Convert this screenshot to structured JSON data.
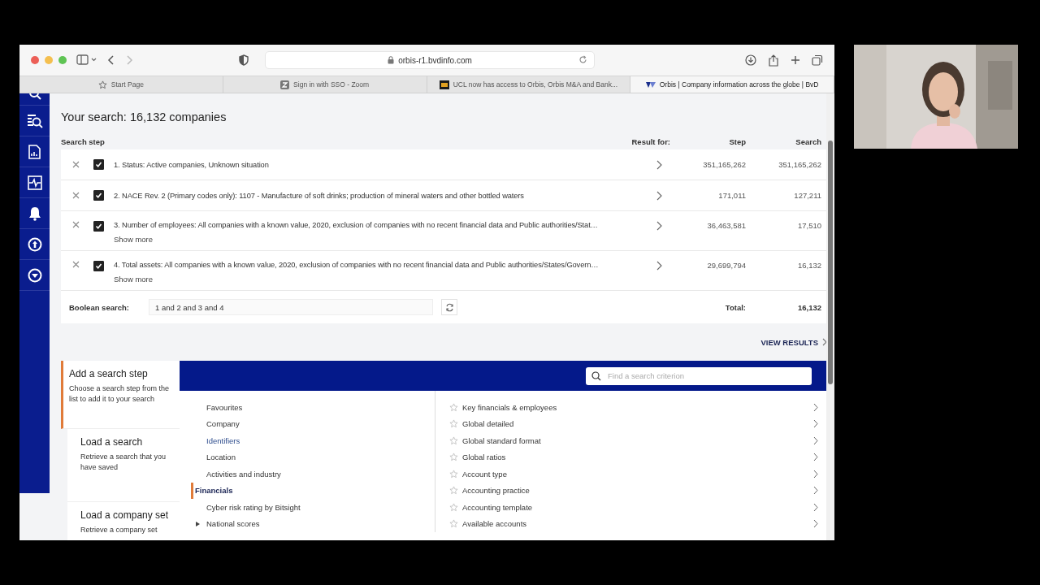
{
  "browser": {
    "url": "orbis-r1.bvdinfo.com",
    "tabs": [
      {
        "label": "Start Page",
        "selected": false,
        "kind": "star"
      },
      {
        "label": "Sign in with SSO - Zoom",
        "selected": false,
        "kind": "zoom"
      },
      {
        "label": "UCL now has access to Orbis, Orbis M&A and Bank...",
        "selected": false,
        "kind": "ucl"
      },
      {
        "label": "Orbis | Company information across the globe | BvD",
        "selected": true,
        "kind": "orbis"
      }
    ]
  },
  "search": {
    "title": "Your search: 16,132 companies",
    "columns": {
      "step_label": "Search step",
      "result_for": "Result for:",
      "step": "Step",
      "search": "Search"
    },
    "steps": [
      {
        "text": "1. Status: Active companies, Unknown situation",
        "checked": true,
        "step": "351,165,262",
        "search": "351,165,262"
      },
      {
        "text": "2. NACE Rev. 2 (Primary codes only): 1107 - Manufacture of soft drinks; production of mineral waters and other bottled waters",
        "checked": true,
        "step": "171,011",
        "search": "127,211"
      },
      {
        "text": "3. Number of employees: All companies with a known value, 2020, exclusion of companies with no recent financial data and Public authorities/Stat…",
        "checked": true,
        "step": "36,463,581",
        "search": "17,510",
        "more": "Show more"
      },
      {
        "text": "4. Total assets: All companies with a known value, 2020, exclusion of companies with no recent financial data and Public authorities/States/Govern…",
        "checked": true,
        "step": "29,699,794",
        "search": "16,132",
        "more": "Show more"
      }
    ],
    "boolean": {
      "label": "Boolean search:",
      "value": "1 and 2 and 3 and 4"
    },
    "total": {
      "label": "Total:",
      "value": "16,132"
    },
    "view_results": "VIEW RESULTS"
  },
  "add_panel": {
    "cards": [
      {
        "title": "Add a search step",
        "description": "Choose a search step from the list to add it to your search",
        "selected": true
      },
      {
        "title": "Load a search",
        "description": "Retrieve a search that you have saved",
        "selected": false
      },
      {
        "title": "Load a company set",
        "description": "Retrieve a company set",
        "selected": false
      }
    ],
    "search_field": {
      "placeholder": "Find a search criterion"
    },
    "categories": [
      {
        "label": "Favourites",
        "selected": false,
        "highlighted": false,
        "expandable": false
      },
      {
        "label": "Company",
        "selected": false,
        "highlighted": false,
        "expandable": false
      },
      {
        "label": "Identifiers",
        "selected": false,
        "highlighted": true,
        "expandable": false
      },
      {
        "label": "Location",
        "selected": false,
        "highlighted": false,
        "expandable": false
      },
      {
        "label": "Activities and industry",
        "selected": false,
        "highlighted": false,
        "expandable": false
      },
      {
        "label": "Financials",
        "selected": true,
        "highlighted": false,
        "expandable": false
      },
      {
        "label": "Cyber risk rating by Bitsight",
        "selected": false,
        "highlighted": false,
        "expandable": false
      },
      {
        "label": "National scores",
        "selected": false,
        "highlighted": false,
        "expandable": true
      }
    ],
    "criteria": [
      "Key financials & employees",
      "Global detailed",
      "Global standard format",
      "Global ratios",
      "Account type",
      "Accounting practice",
      "Accounting template",
      "Available accounts"
    ]
  }
}
